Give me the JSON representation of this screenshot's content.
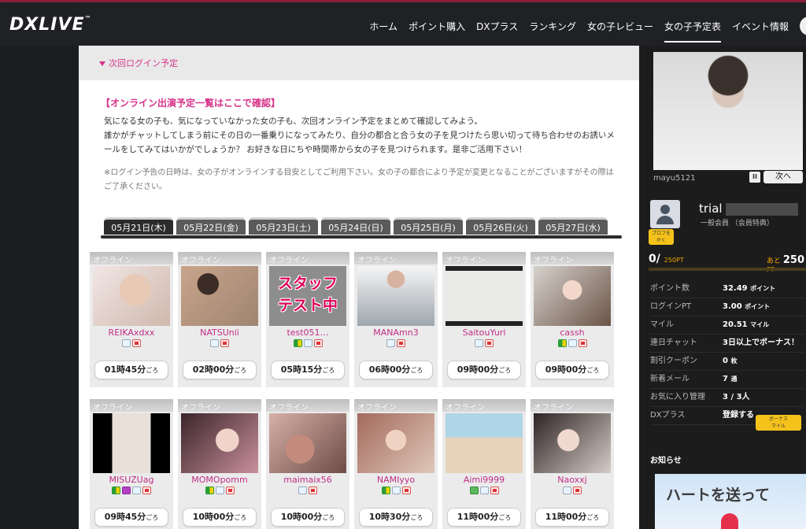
{
  "header": {
    "logo": "DXLIVE",
    "logo_tm": "™",
    "nav": [
      "ホーム",
      "ポイント購入",
      "DXプラス",
      "ランキング",
      "女の子レビュー",
      "女の子予定表",
      "イベント情報"
    ],
    "active_nav_index": 5
  },
  "main": {
    "next_login_label": "次回ログイン予定",
    "intro_title": "【オンライン出演予定一覧はここで確認】",
    "intro_line1": "気になる女の子も、気になっていなかった女の子も、次回オンライン予定をまとめて確認してみよう。",
    "intro_line2": "誰かがチャットしてしまう前にその日の一番乗りになってみたり、自分の都合と合う女の子を見つけたら思い切って待ち合わせのお誘いメールをしてみてはいかがでしょうか？ お好きな日にちや時間帯から女の子を見つけられます。是非ご活用下さい！",
    "note": "※ログイン予告の日時は、女の子がオンラインする目安としてご利用下さい。女の子の都合により予定が変更となることがございますがその際はご了承ください。",
    "tabs": [
      "05月21日(木)",
      "05月22日(金)",
      "05月23日(土)",
      "05月24日(日)",
      "05月25日(月)",
      "05月26日(火)",
      "05月27日(水)"
    ],
    "active_tab_index": 0,
    "performers": [
      {
        "status": "オフライン",
        "name": "REIKAxdxx",
        "icons": [
          "book",
          "red"
        ],
        "time": "01時45分",
        "suffix": "ごろ",
        "photo": "p1",
        "staff": ""
      },
      {
        "status": "オフライン",
        "name": "NATSUnii",
        "icons": [
          "book",
          "red"
        ],
        "time": "02時00分",
        "suffix": "ごろ",
        "photo": "p2",
        "staff": ""
      },
      {
        "status": "オフライン",
        "name": "test051…",
        "icons": [
          "beginner",
          "book",
          "red"
        ],
        "time": "05時15分",
        "suffix": "ごろ",
        "photo": "p3",
        "staff": "スタッフ\nテスト中"
      },
      {
        "status": "オフライン",
        "name": "MANAmn3",
        "icons": [
          "book",
          "red"
        ],
        "time": "06時00分",
        "suffix": "ごろ",
        "photo": "p4",
        "staff": ""
      },
      {
        "status": "オフライン",
        "name": "SaitouYuri",
        "icons": [
          "book",
          "red"
        ],
        "time": "09時00分",
        "suffix": "ごろ",
        "photo": "p5",
        "staff": ""
      },
      {
        "status": "オフライン",
        "name": "cassh",
        "icons": [
          "beginner",
          "book",
          "red"
        ],
        "time": "09時00分",
        "suffix": "ごろ",
        "photo": "p6",
        "staff": ""
      },
      {
        "status": "オフライン",
        "name": "MISUZUag",
        "icons": [
          "beginner",
          "purple",
          "book",
          "red"
        ],
        "time": "09時45分",
        "suffix": "ごろ",
        "photo": "p7",
        "staff": ""
      },
      {
        "status": "オフライン",
        "name": "MOMOpomm",
        "icons": [
          "beginner",
          "book",
          "red"
        ],
        "time": "10時00分",
        "suffix": "ごろ",
        "photo": "p8",
        "staff": ""
      },
      {
        "status": "オフライン",
        "name": "maimaix56",
        "icons": [
          "book",
          "red"
        ],
        "time": "10時00分",
        "suffix": "ごろ",
        "photo": "p9",
        "staff": ""
      },
      {
        "status": "オフライン",
        "name": "NAMIyyo",
        "icons": [
          "beginner",
          "book",
          "red"
        ],
        "time": "10時30分",
        "suffix": "ごろ",
        "photo": "p10",
        "staff": ""
      },
      {
        "status": "オフライン",
        "name": "Aimi9999",
        "icons": [
          "green",
          "book",
          "red"
        ],
        "time": "11時00分",
        "suffix": "ごろ",
        "photo": "p11",
        "staff": ""
      },
      {
        "status": "オフライン",
        "name": "Naoxxj",
        "icons": [
          "book",
          "red"
        ],
        "time": "11時00分",
        "suffix": "ごろ",
        "photo": "p12",
        "staff": ""
      }
    ]
  },
  "sidebar": {
    "featured_name": "mayu5121",
    "pause_label": "II",
    "next_label": "次へ",
    "user_name": "trial",
    "member_type": "一般会員 （会員特典）",
    "profile_badge": "プロフを\nかく",
    "points_current": "0/",
    "points_max": "250PT",
    "points_remaining_prefix": "あと",
    "points_remaining": "250",
    "points_remaining_unit": "PT",
    "points_progress": 0,
    "stats": [
      {
        "label": "ポイント数",
        "value": "32.49",
        "unit": "ポイント"
      },
      {
        "label": "ログインPT",
        "value": "3.00",
        "unit": "ポイント"
      },
      {
        "label": "マイル",
        "value": "20.51",
        "unit": "マイル"
      },
      {
        "label": "連日チャット",
        "value": "3日以上でボーナス！",
        "unit": ""
      },
      {
        "label": "割引クーポン",
        "value": "0",
        "unit": "枚"
      },
      {
        "label": "新着メール",
        "value": "7",
        "unit": "通"
      },
      {
        "label": "お気に入り管理",
        "value": "3 / 3人",
        "unit": ""
      },
      {
        "label": "DXプラス",
        "value": "登録する",
        "unit": ""
      }
    ],
    "bonus_badge": "ボーナス\nマイル",
    "news_title": "お知らせ",
    "news_banner_text": "ハートを送って"
  },
  "colors": {
    "accent_pink": "#d6338a",
    "bg_dark": "#1b1d21",
    "badge_yellow": "#f4c21b"
  }
}
